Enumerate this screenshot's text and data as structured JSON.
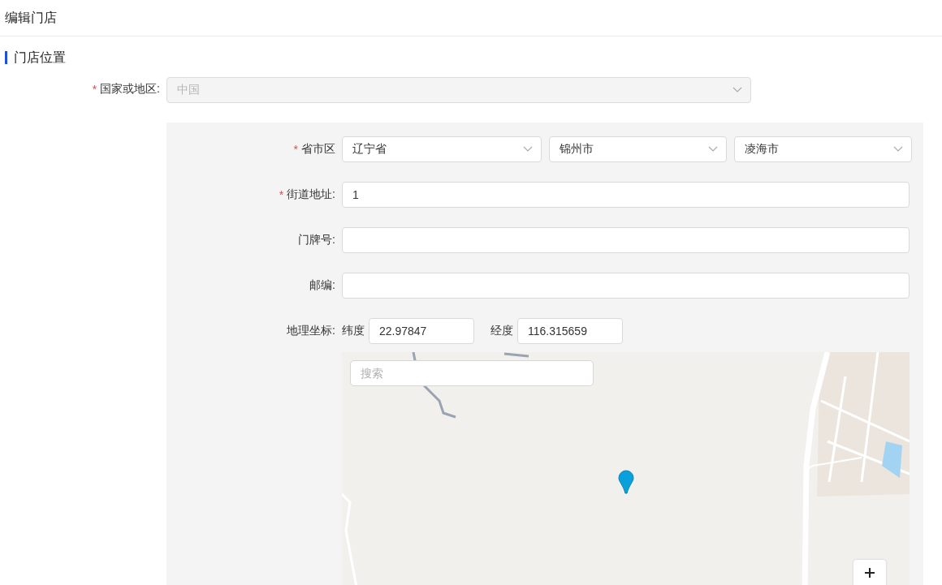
{
  "header": {
    "title": "编辑门店"
  },
  "section": {
    "title": "门店位置"
  },
  "country": {
    "label": "国家或地区:",
    "required_mark": "*",
    "value": "中国",
    "disabled": true
  },
  "region": {
    "label": "省市区",
    "required_mark": "*",
    "selects": [
      {
        "value": "辽宁省"
      },
      {
        "value": "锦州市"
      },
      {
        "value": "凌海市"
      }
    ]
  },
  "fields": [
    {
      "label": "街道地址:",
      "required_mark": "*",
      "value": "1"
    },
    {
      "label": "门牌号:"
    },
    {
      "label": "邮编:"
    }
  ],
  "coordinates": {
    "label": "地理坐标:",
    "latitude": {
      "label": "纬度",
      "value": "22.97847"
    },
    "longitude": {
      "label": "经度",
      "value": "116.315659"
    }
  },
  "map": {
    "kind": "picture",
    "search": {
      "placeholder": "搜索"
    }
  }
}
